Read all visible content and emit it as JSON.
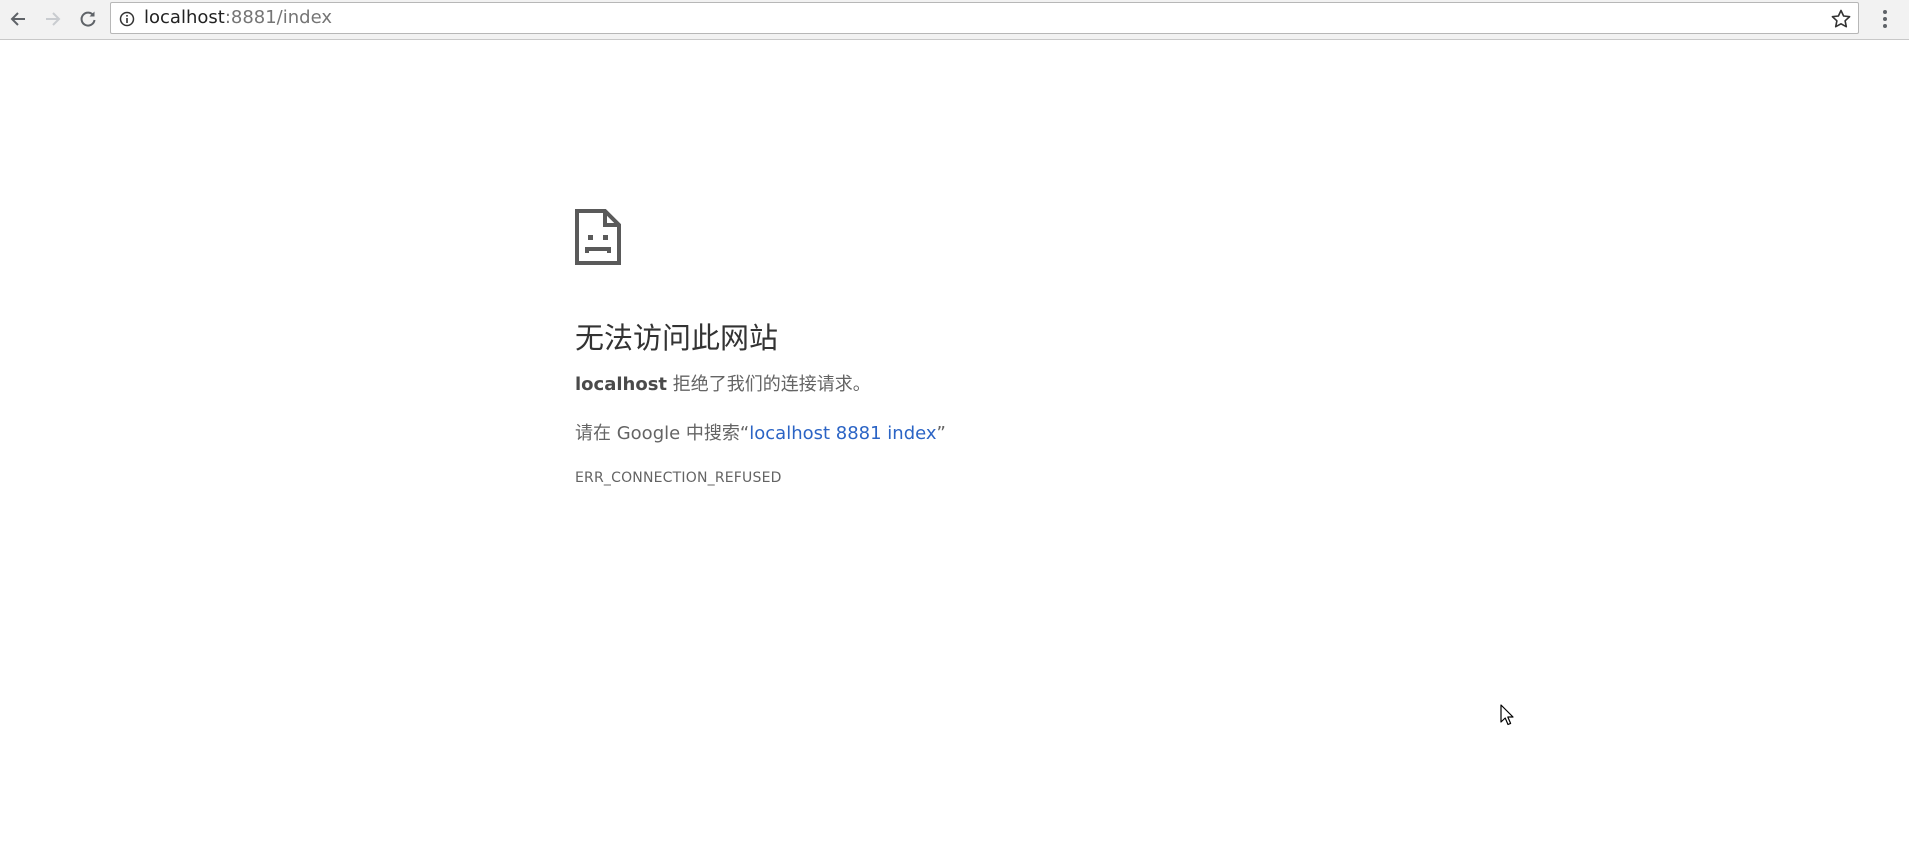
{
  "browser": {
    "url_host": "localhost",
    "url_rest": ":8881/index",
    "icons": {
      "back": "arrow-left-icon",
      "forward": "arrow-right-icon",
      "reload": "reload-icon",
      "site_info": "info-circle-icon",
      "bookmark": "star-icon",
      "menu": "vertical-dots-icon"
    }
  },
  "error_page": {
    "icon": "sad-document-icon",
    "headline": "无法访问此网站",
    "host": "localhost",
    "refused_text": " 拒绝了我们的连接请求。",
    "search_prefix": "请在 Google 中搜索“",
    "search_link": "localhost 8881 index",
    "search_suffix": "”",
    "error_code": "ERR_CONNECTION_REFUSED"
  },
  "colors": {
    "link": "#2b64c5",
    "text": "#646464",
    "headline": "#333333",
    "toolbar": "#f2f2f2"
  }
}
